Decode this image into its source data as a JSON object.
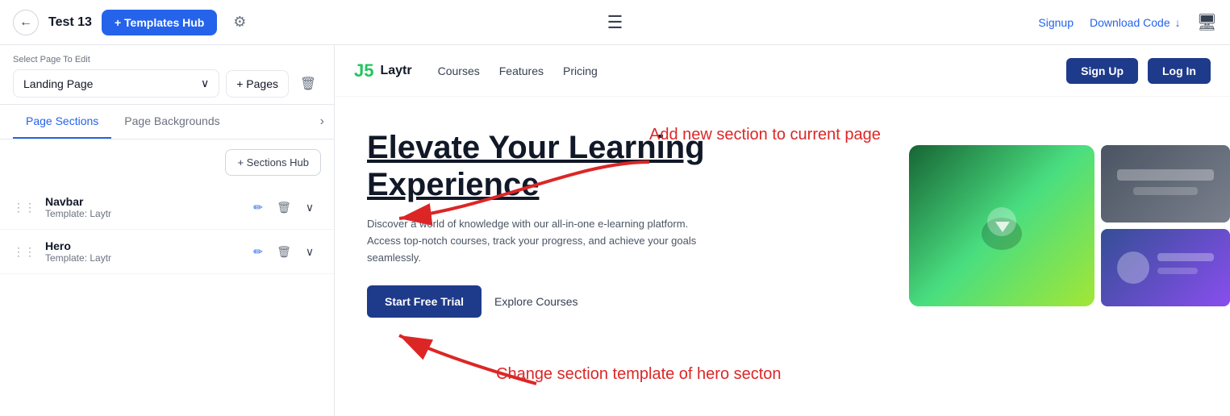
{
  "topbar": {
    "back_icon": "←",
    "app_title": "Test 13",
    "templates_hub_label": "+ Templates Hub",
    "gear_icon": "⚙",
    "hamburger_icon": "☰",
    "signup_label": "Signup",
    "download_label": "Download Code",
    "download_icon": "↓",
    "monitor_icon": "🖥"
  },
  "sidebar": {
    "select_page_label": "Select Page To Edit",
    "page_selected": "Landing Page",
    "chevron_icon": "∨",
    "pages_label": "+ Pages",
    "delete_icon": "🗑",
    "tabs": [
      {
        "label": "Page Sections",
        "active": true
      },
      {
        "label": "Page Backgrounds",
        "active": false
      }
    ],
    "chevron_right": "›",
    "sections_hub_label": "+ Sections Hub",
    "sections": [
      {
        "name": "Navbar",
        "template": "Template: Laytr"
      },
      {
        "name": "Hero",
        "template": "Template: Laytr"
      }
    ],
    "edit_icon": "✏",
    "trash_icon": "🗑",
    "expand_icon": "∨"
  },
  "preview": {
    "brand_icon": "J5",
    "brand_name": "Laytr",
    "nav_links": [
      "Courses",
      "Features",
      "Pricing"
    ],
    "btn_signup": "Sign Up",
    "btn_login": "Log In",
    "hero_title": "Elevate Your Learning Experience",
    "hero_desc": "Discover a world of knowledge with our all-in-one e-learning platform. Access top-notch courses, track your progress, and achieve your goals seamlessly.",
    "btn_trial": "Start Free Trial",
    "btn_explore": "Explore Courses"
  },
  "annotations": {
    "add_section": "Add new section to current page",
    "change_section": "Change section template of hero secton"
  }
}
